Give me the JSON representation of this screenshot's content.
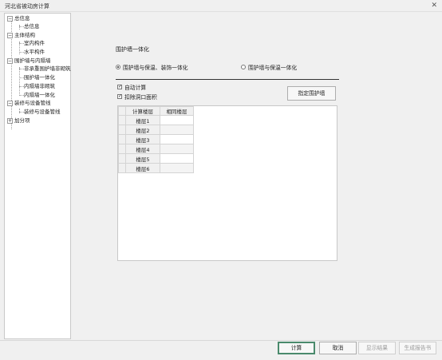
{
  "window": {
    "title": "河北省被动房计算",
    "close_glyph": "✕"
  },
  "tree": {
    "expanded_glyph": "−",
    "collapsed_glyph": "+",
    "nodes": [
      {
        "label": "总信息",
        "children": [
          "总信息"
        ]
      },
      {
        "label": "主体结构",
        "children": [
          "室内构件",
          "水平构件"
        ]
      },
      {
        "label": "围护墙与内隔墙",
        "children": [
          "非承重围护墙非砌筑",
          "围护墙一体化",
          "内隔墙非砌筑",
          "内隔墙一体化"
        ]
      },
      {
        "label": "装修与设备管线",
        "children": [
          "装修与设备管线"
        ]
      },
      {
        "label": "加分项",
        "children": []
      }
    ]
  },
  "main": {
    "section_title": "围护墙一体化",
    "radio_options": [
      {
        "label": "围护墙与保温、装饰一体化",
        "selected": true
      },
      {
        "label": "围护墙与保温一体化",
        "selected": false
      }
    ],
    "checkboxes": [
      {
        "label": "自动计算",
        "checked": true,
        "mark": "✓"
      },
      {
        "label": "扣除洞口面积",
        "checked": true,
        "mark": "✓"
      }
    ],
    "assign_button": "指定围护墙",
    "table": {
      "columns": [
        "计算楼层",
        "相同楼层"
      ],
      "rows": [
        [
          "楼层1",
          ""
        ],
        [
          "楼层2",
          ""
        ],
        [
          "楼层3",
          ""
        ],
        [
          "楼层4",
          ""
        ],
        [
          "楼层5",
          ""
        ],
        [
          "楼层6",
          ""
        ]
      ]
    }
  },
  "footer": {
    "buttons": [
      {
        "label": "计算",
        "enabled": true
      },
      {
        "label": "取消",
        "enabled": true
      },
      {
        "label": "显示结果",
        "enabled": false
      },
      {
        "label": "生成报告书",
        "enabled": false
      }
    ]
  }
}
